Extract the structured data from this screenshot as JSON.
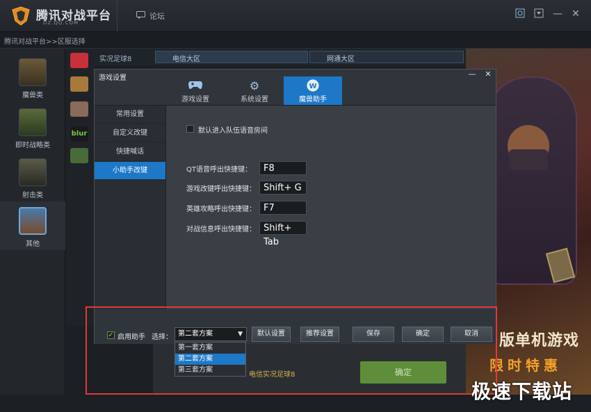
{
  "app": {
    "name": "腾讯对战平台",
    "domain": "DZ.QQ.COM",
    "forum_label": "论坛"
  },
  "breadcrumb": "腾讯对战平台>>区服选择",
  "categories": [
    {
      "label": "魔兽类"
    },
    {
      "label": "即时战略类"
    },
    {
      "label": "射击类"
    },
    {
      "label": "其他"
    }
  ],
  "selected_game": "实况足球8",
  "regions": [
    "电信大区",
    "网通大区"
  ],
  "dialog": {
    "title": "游戏设置",
    "tabs": [
      "游戏设置",
      "系统设置",
      "魔兽助手"
    ],
    "side_menu": [
      "常用设置",
      "自定义改键",
      "快捷喊话",
      "小助手改键"
    ],
    "auto_voice_label": "默认进入队伍语音房间",
    "hotkeys": [
      {
        "label": "QT语音呼出快捷键：",
        "key": "F8"
      },
      {
        "label": "游戏改键呼出快捷键：",
        "key": "Shift+ G"
      },
      {
        "label": "英雄攻略呼出快捷键：",
        "key": "F7"
      },
      {
        "label": "对战信息呼出快捷键：",
        "key": "Shift+ Tab"
      }
    ],
    "enable_helper_label": "启用助手",
    "select_label": "选择：",
    "selected_scheme": "第二套方案",
    "scheme_options": [
      "第一套方案",
      "第二套方案",
      "第三套方案"
    ],
    "buttons": {
      "default": "默认设置",
      "recommend": "推荐设置",
      "save": "保存",
      "ok": "确定",
      "cancel": "取消"
    }
  },
  "background": {
    "region_text": "电信实况足球8",
    "confirm_label": "确定"
  },
  "ad": {
    "line1": "版单机游戏",
    "line2": "限时特惠"
  },
  "watermark": "极速下载站",
  "colors": {
    "accent": "#1e78c8",
    "highlight_box": "#e0393a",
    "confirm_green": "#5f8e3a"
  }
}
